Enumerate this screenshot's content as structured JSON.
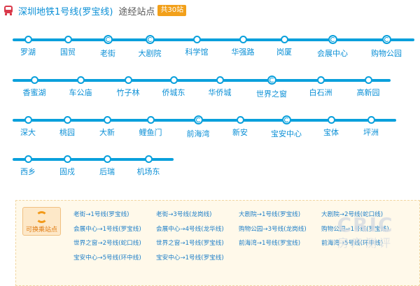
{
  "header": {
    "line_name": "深圳地铁1号线(罗宝线)",
    "subtitle": "途经站点",
    "badge": "共30站"
  },
  "route": {
    "rows": [
      {
        "stations": [
          {
            "name": "罗湖",
            "transfer": false
          },
          {
            "name": "国贸",
            "transfer": false
          },
          {
            "name": "老街",
            "transfer": true
          },
          {
            "name": "大剧院",
            "transfer": true
          },
          {
            "name": "科学馆",
            "transfer": false
          },
          {
            "name": "华强路",
            "transfer": false
          },
          {
            "name": "岗厦",
            "transfer": false
          },
          {
            "name": "会展中心",
            "transfer": true
          },
          {
            "name": "购物公园",
            "transfer": true
          }
        ]
      },
      {
        "stations": [
          {
            "name": "香蜜湖",
            "transfer": false
          },
          {
            "name": "车公庙",
            "transfer": false
          },
          {
            "name": "竹子林",
            "transfer": false
          },
          {
            "name": "侨城东",
            "transfer": false
          },
          {
            "name": "华侨城",
            "transfer": false
          },
          {
            "name": "世界之窗",
            "transfer": true
          },
          {
            "name": "白石洲",
            "transfer": false
          },
          {
            "name": "高新园",
            "transfer": false
          }
        ]
      },
      {
        "stations": [
          {
            "name": "深大",
            "transfer": false
          },
          {
            "name": "桃园",
            "transfer": false
          },
          {
            "name": "大新",
            "transfer": false
          },
          {
            "name": "鲤鱼门",
            "transfer": false
          },
          {
            "name": "前海湾",
            "transfer": true
          },
          {
            "name": "新安",
            "transfer": false
          },
          {
            "name": "宝安中心",
            "transfer": true
          },
          {
            "name": "宝体",
            "transfer": false
          },
          {
            "name": "坪洲",
            "transfer": false
          }
        ]
      },
      {
        "stations": [
          {
            "name": "西乡",
            "transfer": false
          },
          {
            "name": "固戍",
            "transfer": false
          },
          {
            "name": "后瑞",
            "transfer": false
          },
          {
            "name": "机场东",
            "transfer": false
          }
        ]
      }
    ]
  },
  "transfers": {
    "button_label": "可换乘站点",
    "items": [
      "老街→1号线(罗宝线)",
      "老街→3号线(龙岗线)",
      "大剧院→1号线(罗宝线)",
      "大剧院→2号线(蛇口线)",
      "会展中心→1号线(罗宝线)",
      "会展中心→4号线(龙华线)",
      "购物公园→3号线(龙岗线)",
      "购物公园→1号线(罗宝线)",
      "世界之窗→2号线(蛇口线)",
      "世界之窗→1号线(罗宝线)",
      "前海湾→1号线(罗宝线)",
      "前海湾→5号线(环中线)",
      "宝安中心→5号线(环中线)",
      "宝安中心→1号线(罗宝线)"
    ]
  },
  "watermark": {
    "brand": "CRIC",
    "sub": "房产测评"
  }
}
